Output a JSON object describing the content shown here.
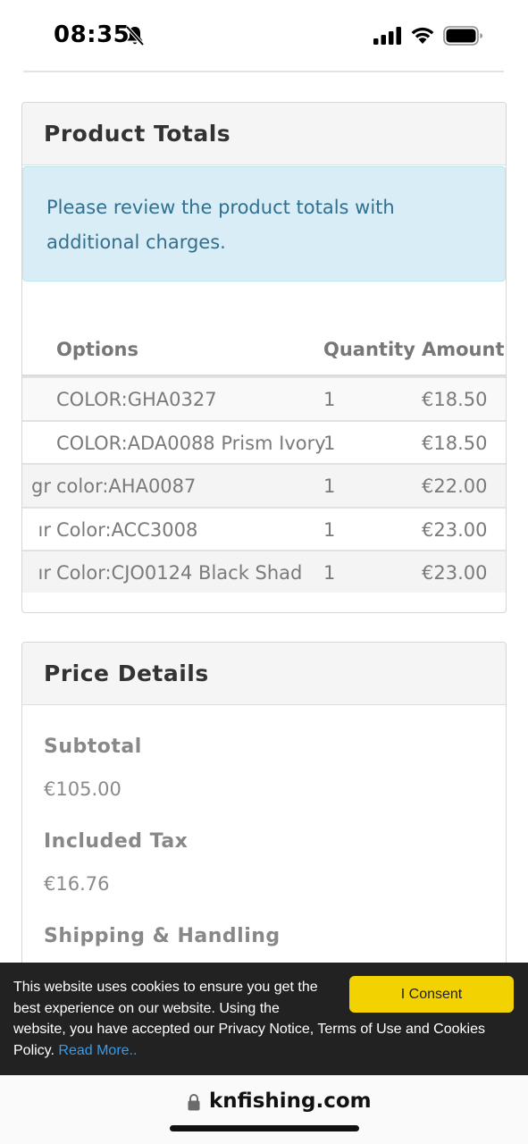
{
  "status_bar": {
    "time": "08:35",
    "icons": [
      "bell-slash-icon",
      "signal-icon",
      "wifi-icon",
      "battery-icon"
    ]
  },
  "product_totals": {
    "heading": "Product Totals",
    "alert": "Please review the product totals with additional charges.",
    "columns": {
      "product": "",
      "options": "Options",
      "quantity": "Quantity",
      "amount": "Amount"
    },
    "rows": [
      {
        "product": "",
        "options": "COLOR:GHA0327",
        "quantity": "1",
        "amount": "€18.50"
      },
      {
        "product": "",
        "options": "COLOR:ADA0088 Prism Ivory",
        "quantity": "1",
        "amount": "€18.50"
      },
      {
        "product": "gr",
        "options": "color:AHA0087",
        "quantity": "1",
        "amount": "€22.00"
      },
      {
        "product": "ır",
        "options": "Color:ACC3008",
        "quantity": "1",
        "amount": "€23.00"
      },
      {
        "product": "ır",
        "options": "Color:CJO0124 Black Shad",
        "quantity": "1",
        "amount": "€23.00"
      }
    ]
  },
  "price_details": {
    "heading": "Price Details",
    "subtotal_label": "Subtotal",
    "subtotal_value": "€105.00",
    "tax_label": "Included Tax",
    "tax_value": "€16.76",
    "shipping_label": "Shipping & Handling"
  },
  "cookie_banner": {
    "text": "This website uses cookies to ensure you get the best experience on our website. Using the website, you have accepted our Privacy Notice, Terms of Use and Cookies Policy.",
    "read_more": "Read More..",
    "consent_label": "I Consent",
    "consent_color": "#f2d200"
  },
  "browser": {
    "url": "knfishing.com"
  }
}
